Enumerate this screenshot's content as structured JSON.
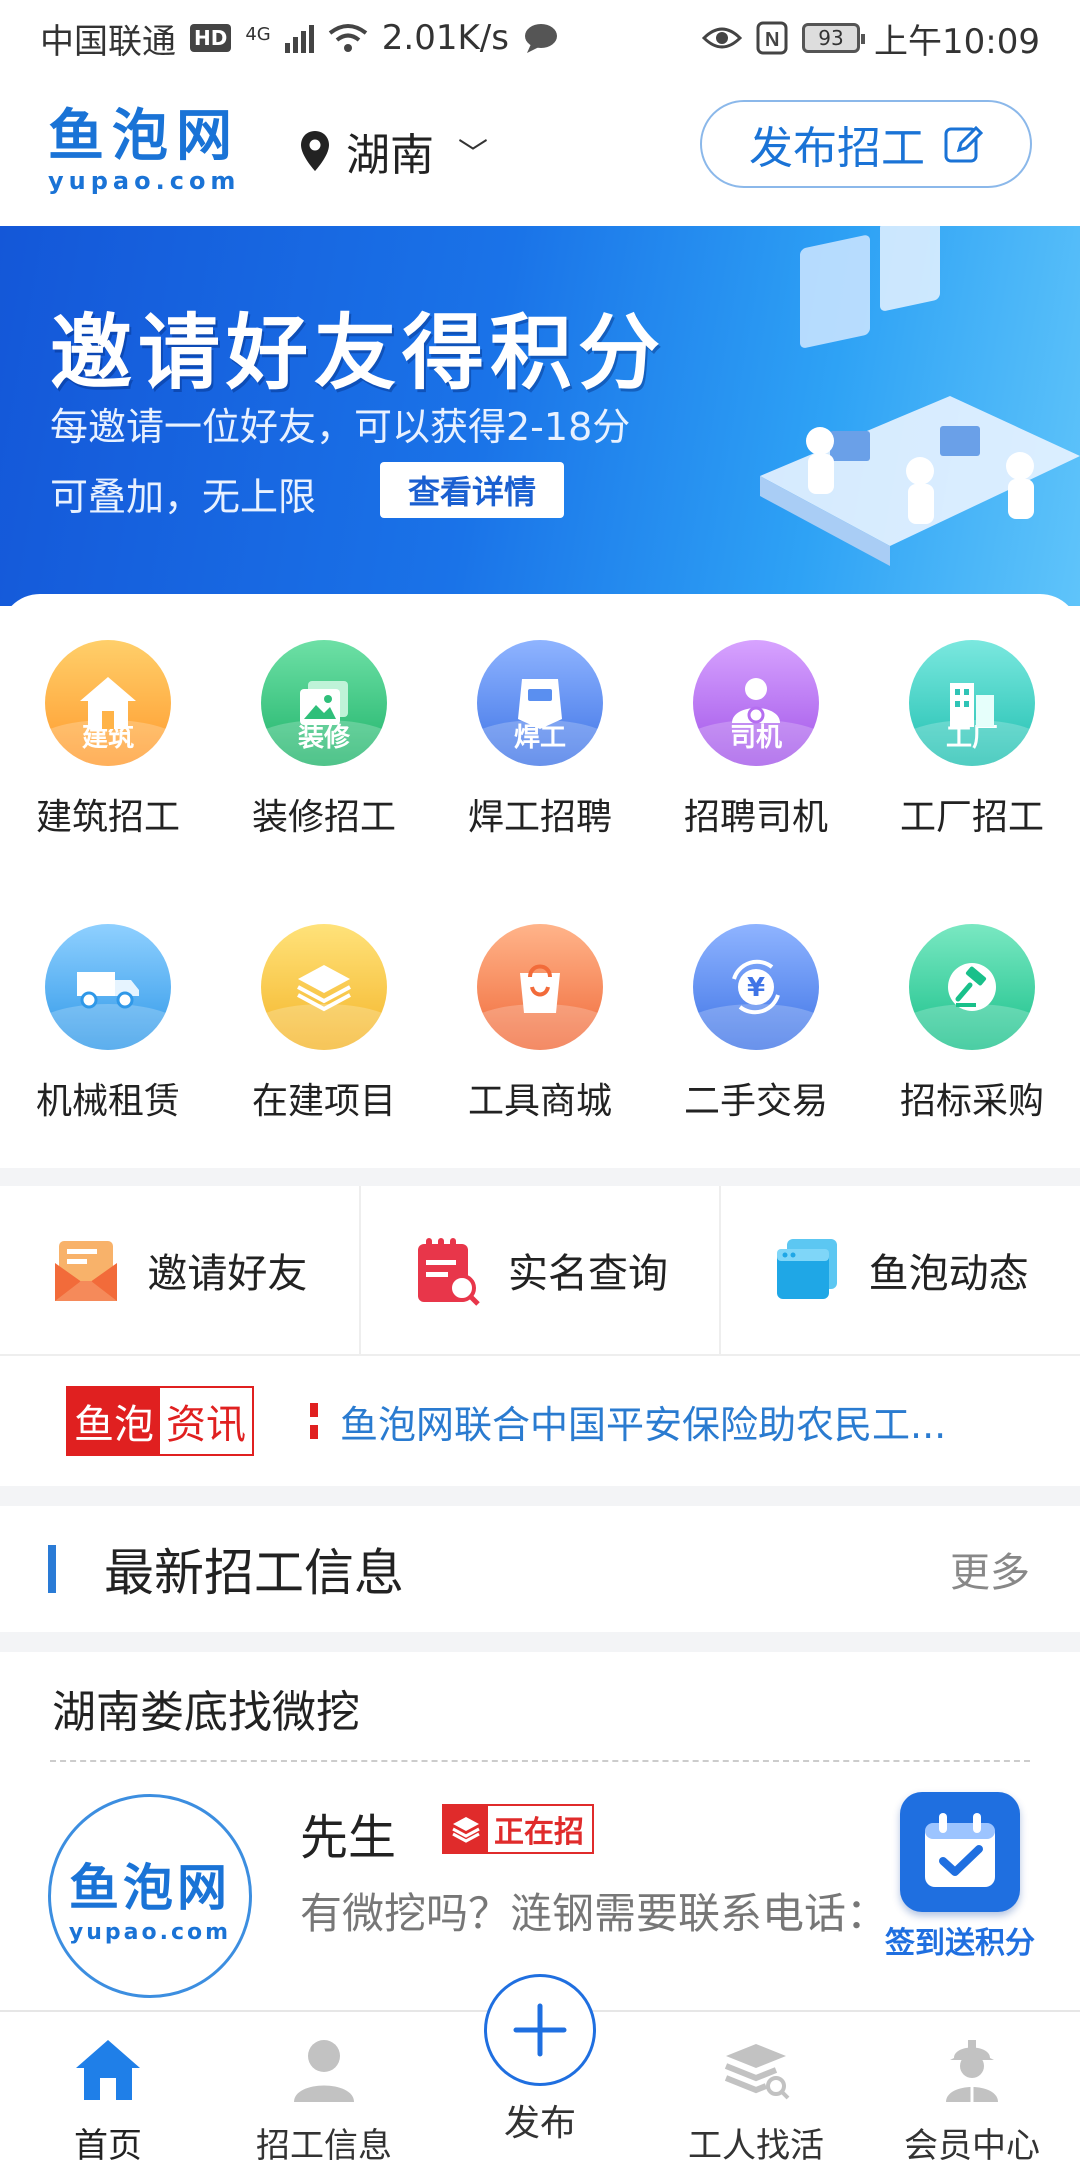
{
  "status_bar": {
    "carrier": "中国联通",
    "hd": "HD",
    "network": "4G",
    "speed": "2.01K/s",
    "battery": "93",
    "time": "上午10:09"
  },
  "header": {
    "logo_cn": "鱼泡网",
    "logo_en": "yupao.com",
    "location": "湖南",
    "post_button": "发布招工"
  },
  "banner": {
    "title": "邀请好友得积分",
    "line1": "每邀请一位好友，可以获得2-18分",
    "line2": "可叠加，无上限",
    "button": "查看详情"
  },
  "categories": [
    {
      "label": "建筑招工",
      "tag": "建筑",
      "icon": "house-icon",
      "color_top": "#ffcf6a",
      "color_bottom": "#ff9a2e"
    },
    {
      "label": "装修招工",
      "tag": "装修",
      "icon": "picture-icon",
      "color_top": "#6ee0a6",
      "color_bottom": "#1fb36a"
    },
    {
      "label": "焊工招聘",
      "tag": "焊工",
      "icon": "welding-mask-icon",
      "color_top": "#8fb4ff",
      "color_bottom": "#3f74e6"
    },
    {
      "label": "招聘司机",
      "tag": "司机",
      "icon": "driver-icon",
      "color_top": "#d7a3ff",
      "color_bottom": "#a154e8"
    },
    {
      "label": "工厂招工",
      "tag": "工厂",
      "icon": "factory-icon",
      "color_top": "#7be8df",
      "color_bottom": "#1fbfb0"
    },
    {
      "label": "机械租赁",
      "tag": "",
      "icon": "truck-icon",
      "color_top": "#8fd0ff",
      "color_bottom": "#2f98e8"
    },
    {
      "label": "在建项目",
      "tag": "",
      "icon": "layers-icon",
      "color_top": "#ffe27a",
      "color_bottom": "#f4b52a"
    },
    {
      "label": "工具商城",
      "tag": "",
      "icon": "shopping-bag-icon",
      "color_top": "#ffb48a",
      "color_bottom": "#f06a3a"
    },
    {
      "label": "二手交易",
      "tag": "",
      "icon": "yuan-exchange-icon",
      "color_top": "#8fb4ff",
      "color_bottom": "#3f74e6"
    },
    {
      "label": "招标采购",
      "tag": "",
      "icon": "gavel-icon",
      "color_top": "#7ae8c2",
      "color_bottom": "#19c08a"
    }
  ],
  "quick_links": [
    {
      "label": "邀请好友",
      "icon": "invite-envelope-icon"
    },
    {
      "label": "实名查询",
      "icon": "id-search-icon"
    },
    {
      "label": "鱼泡动态",
      "icon": "news-card-icon"
    }
  ],
  "news": {
    "badge_a": "鱼泡",
    "badge_b": "资讯",
    "text": "鱼泡网联合中国平安保险助农民工..."
  },
  "section": {
    "title": "最新招工信息",
    "more": "更多"
  },
  "job": {
    "title": "湖南娄底找微挖",
    "avatar_cn": "鱼泡网",
    "avatar_en": "yupao.com",
    "name": "先生",
    "status": "正在招",
    "desc": "有微挖吗？涟钢需要联系电话："
  },
  "checkin": {
    "label": "签到送积分"
  },
  "tabbar": {
    "home": "首页",
    "jobs": "招工信息",
    "publish": "发布",
    "find_work": "工人找活",
    "member": "会员中心"
  },
  "colors": {
    "brand_blue": "#1a73d6",
    "news_red": "#e02020",
    "link_blue": "#2a7bd0"
  }
}
